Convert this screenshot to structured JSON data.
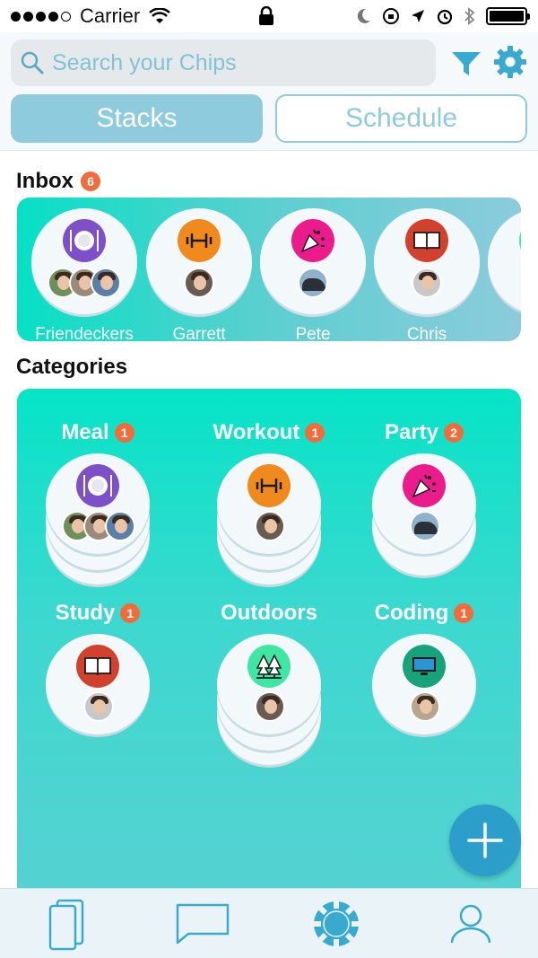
{
  "status_bar": {
    "carrier": "Carrier"
  },
  "search": {
    "placeholder": "Search your Chips"
  },
  "tabs": {
    "stacks": "Stacks",
    "schedule": "Schedule"
  },
  "inbox": {
    "title": "Inbox",
    "count": "6",
    "items": [
      {
        "name": "Friendeckers",
        "icon": "plate-icon",
        "color": "#7d4fc9",
        "avatars": 3
      },
      {
        "name": "Garrett",
        "icon": "dumbbell-icon",
        "color": "#f08a1c",
        "avatars": 1
      },
      {
        "name": "Pete",
        "icon": "party-popper-icon",
        "color": "#ec1b8c",
        "avatars": 1
      },
      {
        "name": "Chris",
        "icon": "book-icon",
        "color": "#d2412e",
        "avatars": 1
      }
    ]
  },
  "categories": {
    "title": "Categories",
    "items": [
      {
        "name": "Meal",
        "count": "1",
        "icon": "plate-icon",
        "color": "#7d4fc9"
      },
      {
        "name": "Workout",
        "count": "1",
        "icon": "dumbbell-icon",
        "color": "#f08a1c"
      },
      {
        "name": "Party",
        "count": "2",
        "icon": "party-popper-icon",
        "color": "#ec1b8c"
      },
      {
        "name": "Study",
        "count": "1",
        "icon": "book-icon",
        "color": "#d2412e"
      },
      {
        "name": "Outdoors",
        "count": "",
        "icon": "trees-icon",
        "color": "#3fe6a4"
      },
      {
        "name": "Coding",
        "count": "1",
        "icon": "monitor-icon",
        "color": "#18a27c"
      }
    ]
  },
  "tab_bar": {
    "items": [
      {
        "icon": "cards-icon"
      },
      {
        "icon": "chat-icon"
      },
      {
        "icon": "chip-icon"
      },
      {
        "icon": "profile-icon"
      }
    ]
  },
  "colors": {
    "accent": "#8ecbdd",
    "teal": "#05e4c6",
    "badge": "#f26b3a",
    "fab": "#2b9fc9"
  }
}
